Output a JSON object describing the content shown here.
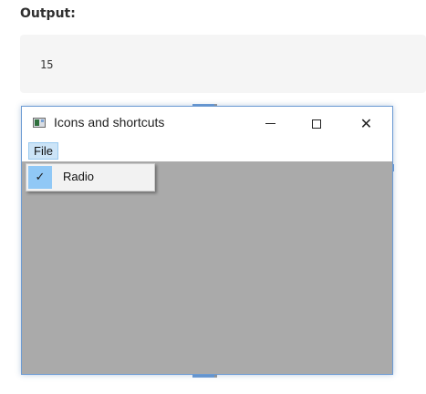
{
  "document": {
    "heading": "Output:",
    "code_output": "15"
  },
  "window": {
    "title": "Icons and shortcuts",
    "icon": "app-window-icon",
    "controls": {
      "minimize_icon": "minimize-icon",
      "maximize_icon": "maximize-icon",
      "close_glyph": "✕"
    }
  },
  "menubar": {
    "menus": [
      {
        "label": "File",
        "open": true
      }
    ]
  },
  "dropdown": {
    "items": [
      {
        "label": "Radio",
        "checked": true,
        "check_glyph": "✓"
      }
    ]
  },
  "colors": {
    "window_border": "#6c9bd3",
    "client_area": "#aaaaaa",
    "menu_highlight": "#cce4f7",
    "check_highlight": "#90c8f6"
  }
}
